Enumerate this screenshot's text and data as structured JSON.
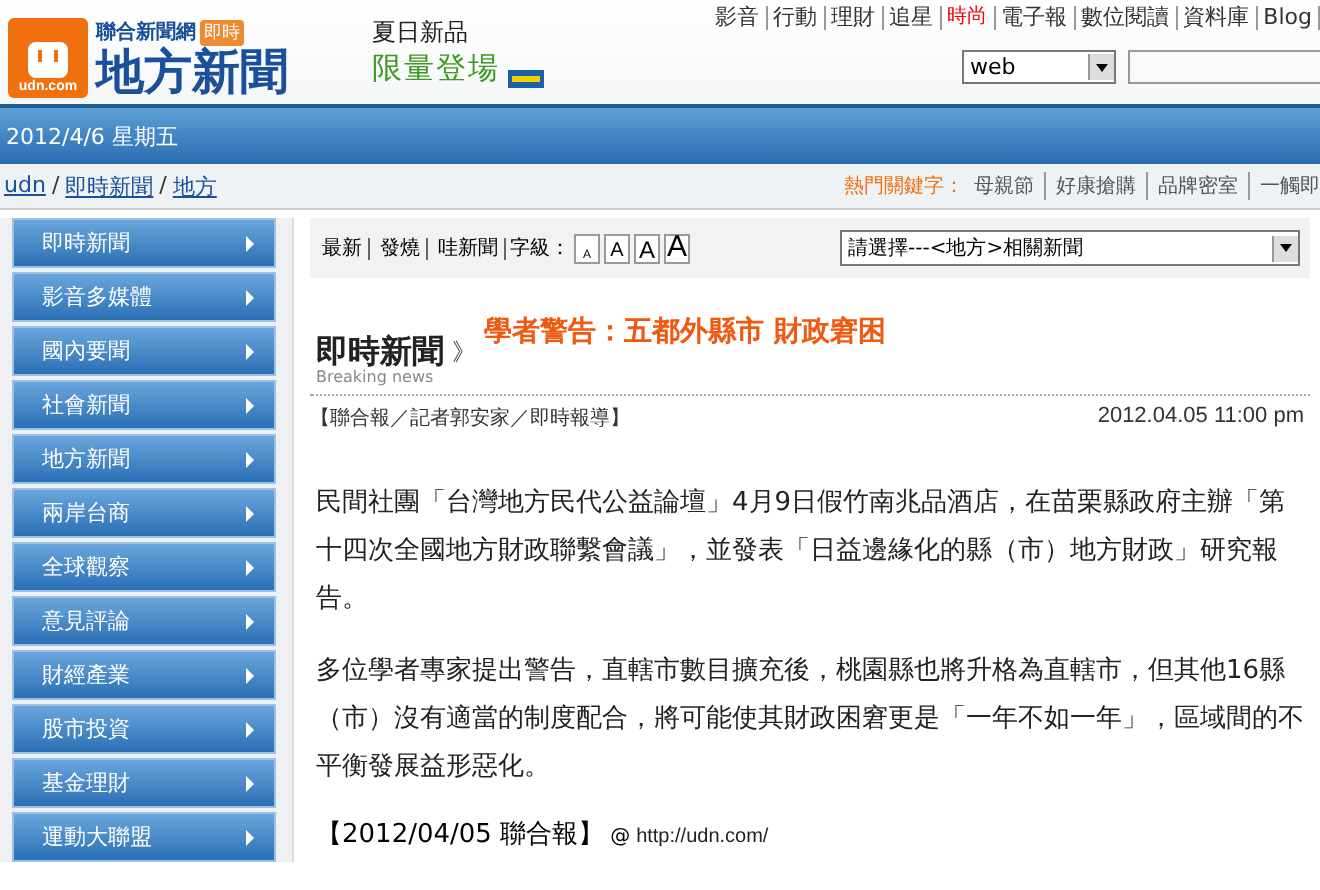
{
  "header": {
    "logo": {
      "site": "聯合新聞網",
      "badge": "即時",
      "title": "地方新聞",
      "domain": "udn.com"
    },
    "ad": {
      "line1": "夏日新品",
      "line2": "限量登場"
    },
    "top_links": [
      {
        "label": "影音",
        "highlight": false
      },
      {
        "label": "行動",
        "highlight": false
      },
      {
        "label": "理財",
        "highlight": false
      },
      {
        "label": "追星",
        "highlight": false
      },
      {
        "label": "時尚",
        "highlight": true
      },
      {
        "label": "電子報",
        "highlight": false
      },
      {
        "label": "數位閱讀",
        "highlight": false
      },
      {
        "label": "資料庫",
        "highlight": false
      },
      {
        "label": "Blog",
        "highlight": false
      }
    ],
    "search": {
      "scope": "web"
    }
  },
  "date_bar": {
    "date": "2012/4/6 星期五"
  },
  "breadcrumb": {
    "separator": "/",
    "items": [
      "udn",
      "即時新聞",
      "地方"
    ]
  },
  "hot_keywords": {
    "label": "熱門關鍵字：",
    "items": [
      "母親節",
      "好康搶購",
      "品牌密室",
      "一觸即"
    ]
  },
  "sidebar": {
    "items": [
      "即時新聞",
      "影音多媒體",
      "國內要聞",
      "社會新聞",
      "地方新聞",
      "兩岸台商",
      "全球觀察",
      "意見評論",
      "財經產業",
      "股市投資",
      "基金理財",
      "運動大聯盟"
    ]
  },
  "toolbar": {
    "links": [
      "最新",
      "發燒",
      "哇新聞"
    ],
    "font_label": "字級：",
    "font_sizes": [
      "A",
      "A",
      "A",
      "A"
    ],
    "related": "請選擇---<地方>相關新聞"
  },
  "article": {
    "section": "即時新聞",
    "section_sub": "Breaking news",
    "separator": "》",
    "headline": "學者警告：五都外縣市 財政窘困",
    "byline": "【聯合報／記者郭安家／即時報導】",
    "datetime": "2012.04.05 11:00 pm",
    "paragraphs": [
      "民間社團「台灣地方民代公益論壇」4月9日假竹南兆品酒店，在苗栗縣政府主辦「第十四次全國地方財政聯繫會議」，並發表「日益邊緣化的縣（市）地方財政」研究報告。",
      "多位學者專家提出警告，直轄市數目擴充後，桃園縣也將升格為直轄市，但其他16縣（市）沒有適當的制度配合，將可能使其財政困窘更是「一年不如一年」，區域間的不平衡發展益形惡化。"
    ],
    "source": "【2012/04/05 聯合報】",
    "source_at": "@",
    "source_url": "http://udn.com/"
  }
}
